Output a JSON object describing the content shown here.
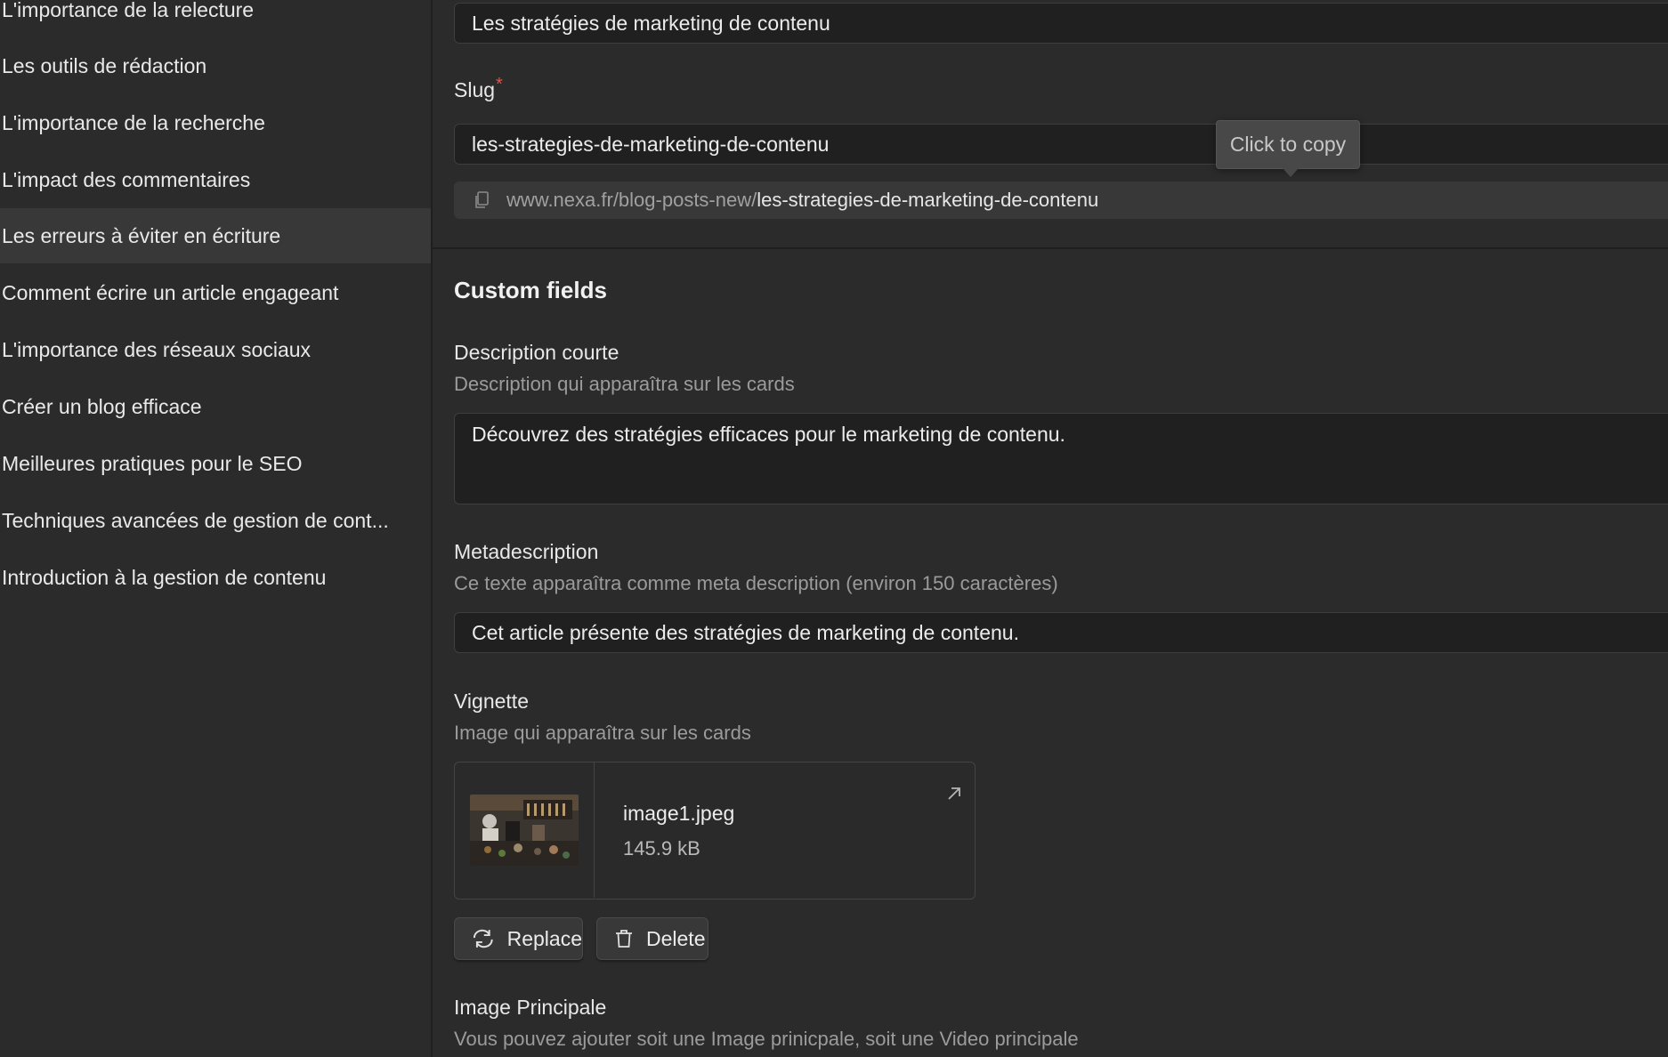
{
  "sidebar": {
    "items": [
      {
        "label": "L'importance de la relecture"
      },
      {
        "label": "Les outils de rédaction"
      },
      {
        "label": "L'importance de la recherche"
      },
      {
        "label": "L'impact des commentaires"
      },
      {
        "label": "Les erreurs à éviter en écriture",
        "active": true
      },
      {
        "label": "Comment écrire un article engageant"
      },
      {
        "label": "L'importance des réseaux sociaux"
      },
      {
        "label": "Créer un blog efficace"
      },
      {
        "label": "Meilleures pratiques pour le SEO"
      },
      {
        "label": "Techniques avancées de gestion de cont..."
      },
      {
        "label": "Introduction à la gestion de contenu"
      }
    ]
  },
  "form": {
    "name_value": "Les stratégies de marketing de contenu",
    "slug_label": "Slug",
    "slug_required": "*",
    "slug_value": "les-strategies-de-marketing-de-contenu",
    "tooltip": "Click to copy",
    "url_base": "www.nexa.fr/blog-posts-new/",
    "url_slug": "les-strategies-de-marketing-de-contenu",
    "section_title": "Custom fields",
    "description": {
      "label": "Description courte",
      "hint": "Description qui apparaîtra sur les cards",
      "value": "Découvrez des stratégies efficaces pour le marketing de contenu."
    },
    "metadescription": {
      "label": "Metadescription",
      "hint": "Ce texte apparaîtra comme meta description (environ 150 caractères)",
      "value": "Cet article présente des stratégies de marketing de contenu."
    },
    "vignette": {
      "label": "Vignette",
      "hint": "Image qui apparaîtra sur les cards",
      "file_name": "image1.jpeg",
      "file_size": "145.9 kB",
      "replace_label": "Replace",
      "delete_label": "Delete"
    },
    "image_principale": {
      "label": "Image Principale",
      "hint": "Vous pouvez ajouter soit une Image prinicpale, soit une Video principale"
    }
  },
  "icons": [
    "copy-icon",
    "open-external-icon",
    "replace-icon",
    "trash-icon"
  ],
  "colors": {
    "background": "#2b2b2b",
    "input": "#202020",
    "required": "#e5534b",
    "hint": "#9b9b9b"
  }
}
